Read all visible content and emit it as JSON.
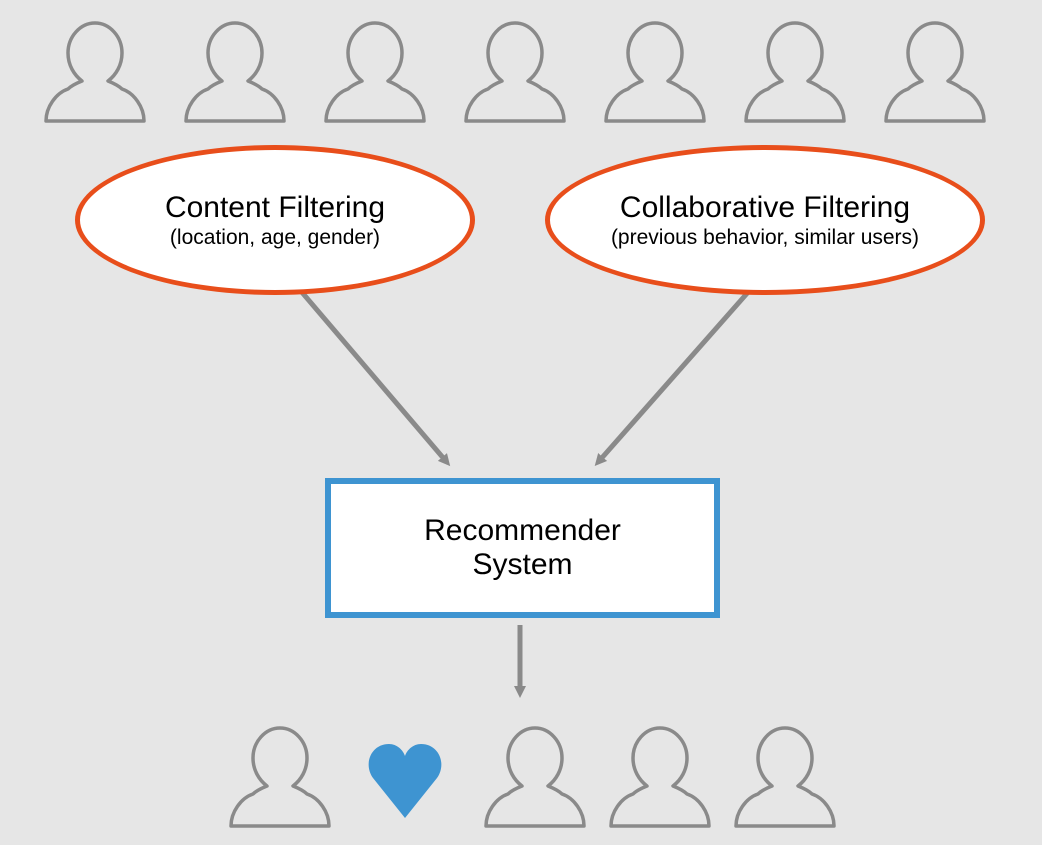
{
  "diagram": {
    "nodes": {
      "content_filtering": {
        "title": "Content Filtering",
        "subtitle": "(location, age, gender)"
      },
      "collaborative_filtering": {
        "title": "Collaborative Filtering",
        "subtitle": "(previous behavior, similar users)"
      },
      "recommender_system": {
        "line1": "Recommender",
        "line2": "System"
      }
    },
    "colors": {
      "ellipse_border": "#E84E1B",
      "rect_border": "#3E94D1",
      "arrow": "#8A8A8A",
      "silhouette": "#8A8A8A",
      "heart": "#3E94D1",
      "background": "#E6E6E6",
      "node_fill": "#FFFFFF"
    },
    "top_users_count": 7,
    "bottom_match": {
      "left_count": 1,
      "right_count": 3
    }
  }
}
